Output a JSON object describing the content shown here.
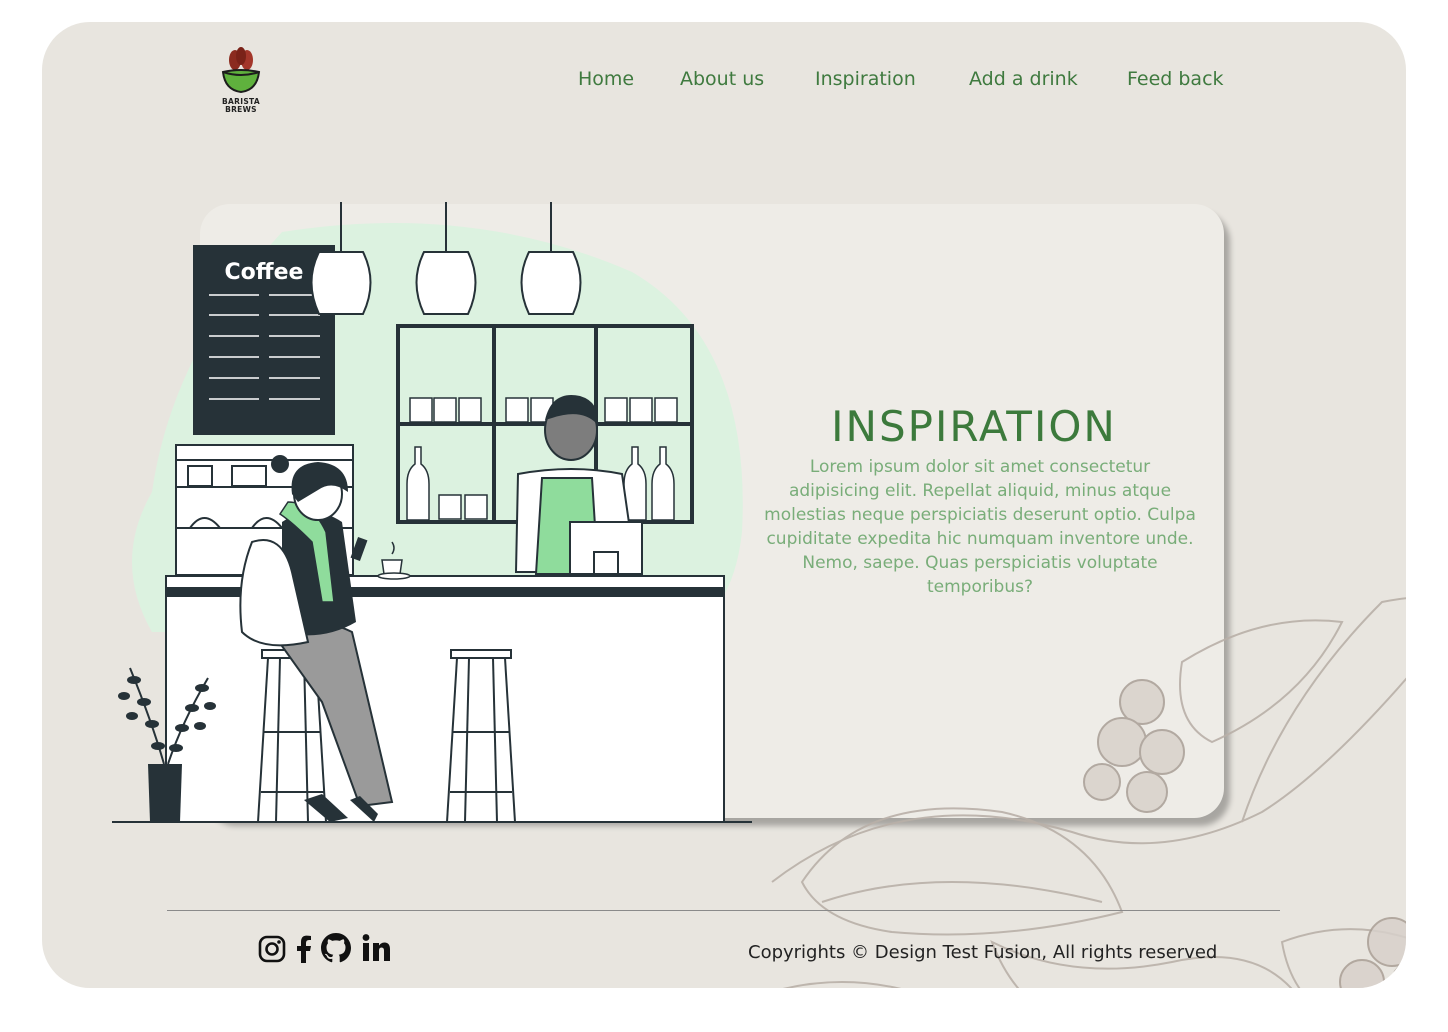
{
  "brand": {
    "logo_text_line1": "BARISTA",
    "logo_text_line2": "BREWS"
  },
  "nav": {
    "items": [
      {
        "label": "Home"
      },
      {
        "label": "About us"
      },
      {
        "label": "Inspiration"
      },
      {
        "label": "Add a drink"
      },
      {
        "label": "Feed back"
      }
    ]
  },
  "hero": {
    "title": "INSPIRATION",
    "body": "Lorem ipsum dolor sit amet consectetur adipisicing elit. Repellat aliquid, minus atque molestias neque perspiciatis deserunt optio. Culpa cupiditate expedita hic numquam inventore unde. Nemo, saepe. Quas perspiciatis voluptate temporibus?",
    "menu_board_text": "Coffee"
  },
  "footer": {
    "social_icons": [
      "instagram-icon",
      "facebook-icon",
      "github-icon",
      "linkedin-icon"
    ],
    "copyright": "Copyrights © Design Test Fusion, All rights reserved"
  },
  "colors": {
    "page_bg": "#ffffff",
    "frame_bg": "#e8e5df",
    "card_bg": "#eeece7",
    "accent_green": "#3c7a3c",
    "body_green": "#79ad79",
    "mint": "#dcf2e0",
    "dark": "#263238"
  }
}
